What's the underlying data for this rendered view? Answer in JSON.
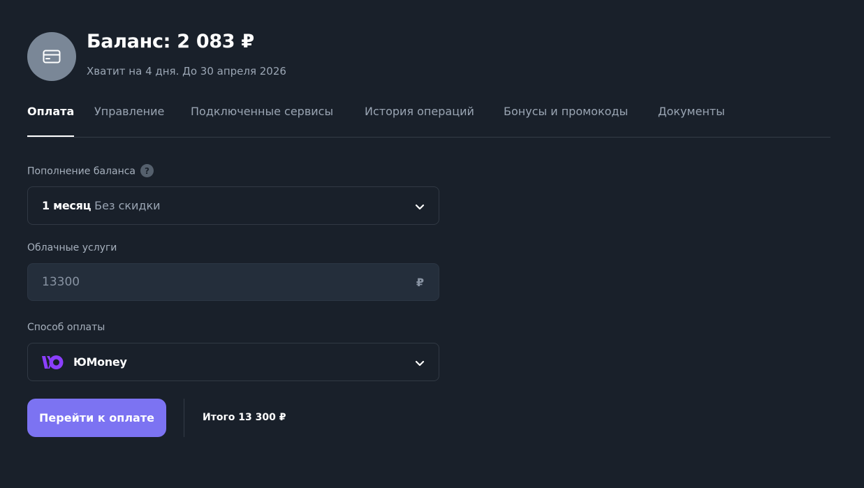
{
  "header": {
    "balance_title": "Баланс: 2 083 ₽",
    "balance_subtitle": "Хватит на 4 дня. До 30 апреля 2026",
    "avatar_icon": "credit-card-icon"
  },
  "tabs": [
    {
      "label": "Оплата",
      "active": true
    },
    {
      "label": "Управление",
      "active": false
    },
    {
      "label": "Подключенные сервисы",
      "active": false
    },
    {
      "label": "История операций",
      "active": false
    },
    {
      "label": "Бонусы и промокоды",
      "active": false
    },
    {
      "label": "Документы",
      "active": false
    }
  ],
  "form": {
    "topup": {
      "label": "Пополнение баланса",
      "help_icon": "question-icon",
      "selected_period": "1 месяц",
      "selected_discount": "Без скидки"
    },
    "cloud": {
      "label": "Облачные услуги",
      "value": "13300",
      "currency": "₽"
    },
    "payment": {
      "label": "Способ оплаты",
      "method_icon": "yumoney-logo-icon",
      "method": "ЮMoney"
    }
  },
  "footer": {
    "pay_button": "Перейти к оплате",
    "total": "Итого 13 300 ₽"
  },
  "colors": {
    "background": "#19202a",
    "accent": "#7c73f2",
    "yumoney": "#8b3ffd"
  }
}
